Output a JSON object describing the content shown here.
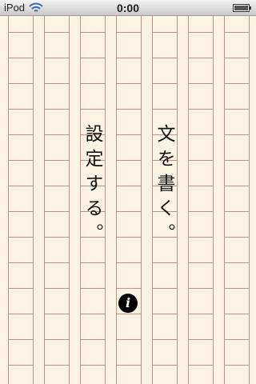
{
  "status_bar": {
    "carrier": "iPod",
    "time": "0:00",
    "wifi_icon": "wifi-icon",
    "battery_icon": "battery-icon"
  },
  "paper": {
    "line_color": "#c98f85",
    "background": "#fdf4e3"
  },
  "actions": {
    "write": "文を書く。",
    "settings": "設定する。"
  },
  "info_button": {
    "label": "i",
    "icon": "info-icon"
  }
}
